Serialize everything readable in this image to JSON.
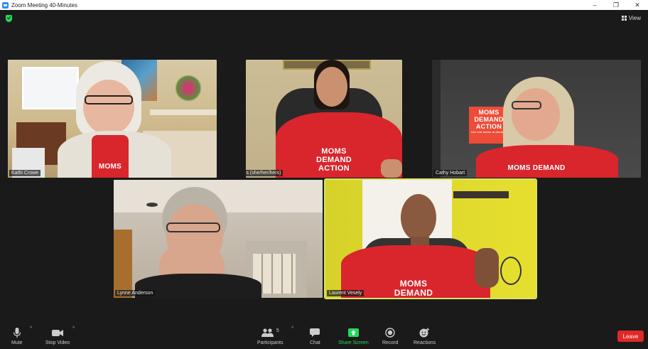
{
  "window": {
    "title": "Zoom Meeting 40-Minutes",
    "minimize": "–",
    "maximize": "❐",
    "close": "✕"
  },
  "header": {
    "view_label": "View"
  },
  "participants": [
    {
      "name": "Kathi Crowe"
    },
    {
      "name": "Faith Evans (she/her/hers)"
    },
    {
      "name": "Cathy Hobart"
    },
    {
      "name": "Lynne Anderson"
    },
    {
      "name": "Laurent Vesely"
    }
  ],
  "shirt_texts": {
    "kathi": "MOMS",
    "faith": [
      "MOMS",
      "DEMAND",
      "ACTION"
    ],
    "cathy": "MOMS DEMAND",
    "poster": [
      "MOMS",
      "DEMAND",
      "ACTION",
      "FOR GUN SENSE IN AMERICA"
    ],
    "laurent": [
      "MOMS",
      "DEMAND"
    ]
  },
  "toolbar": {
    "mute": "Mute",
    "stop_video": "Stop Video",
    "participants": "Participants",
    "participants_count": "5",
    "chat": "Chat",
    "share_screen": "Share Screen",
    "record": "Record",
    "reactions": "Reactions",
    "leave": "Leave",
    "caret": "^"
  },
  "colors": {
    "accent_green": "#23d959",
    "leave_red": "#e02828",
    "shirt_red": "#d8262c",
    "active_speaker_border": "#d9e26a"
  }
}
